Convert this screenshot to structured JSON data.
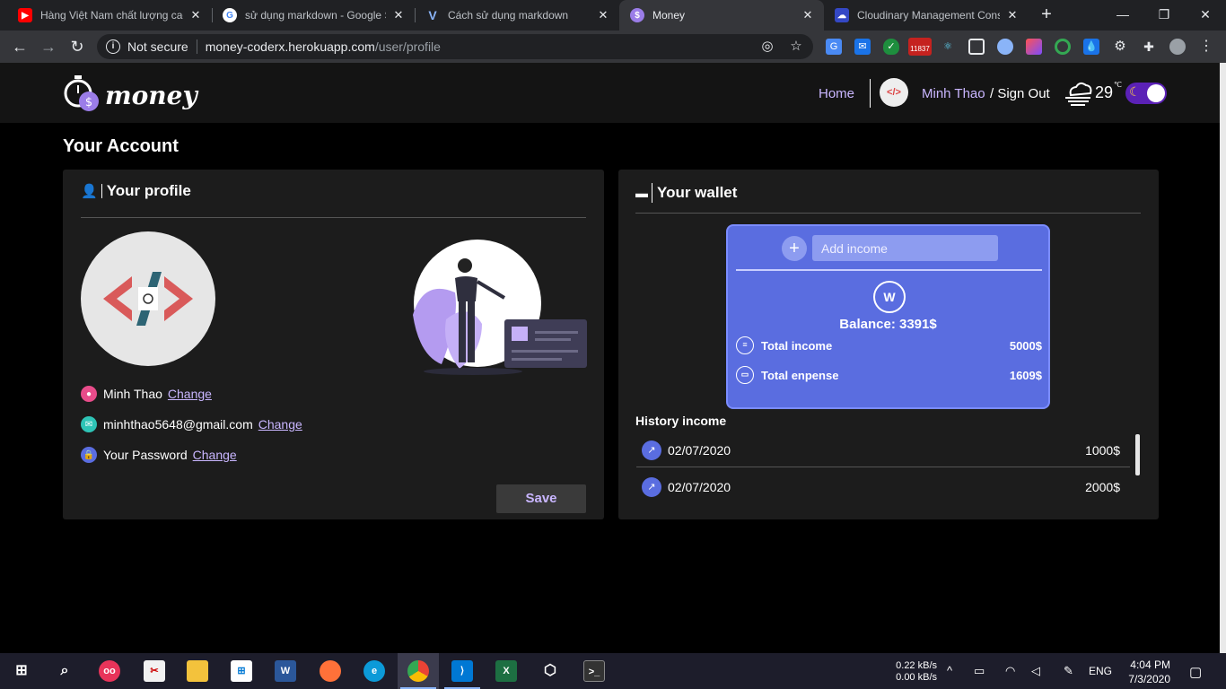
{
  "browser": {
    "tabs": [
      {
        "title": "Hàng Việt Nam chất lượng cao",
        "icon": "youtube-icon",
        "active": false
      },
      {
        "title": "sử dụng markdown - Google S",
        "icon": "google-icon",
        "active": false
      },
      {
        "title": "Cách sử dụng markdown",
        "icon": "v-icon",
        "active": false
      },
      {
        "title": "Money",
        "icon": "money-icon",
        "active": true
      },
      {
        "title": "Cloudinary Management Cons",
        "icon": "cloudinary-icon",
        "active": false
      }
    ],
    "close_glyph": "✕",
    "security_label": "Not secure",
    "url_host": "money-coderx.herokuapp.com",
    "url_path": "/user/profile",
    "ext_badge": "11837"
  },
  "navbar": {
    "logo_text": "money",
    "home_label": "Home",
    "user_name": "Minh Thao",
    "signout_label": "/ Sign Out",
    "temperature": "29",
    "temp_unit": "℃",
    "avatar_glyph": "</>"
  },
  "page_title": "Your Account",
  "profile": {
    "heading": "Your profile",
    "name": "Minh Thao",
    "email": "minhthao5648@gmail.com",
    "password_label": "Your Password",
    "change_label": "Change",
    "save_label": "Save"
  },
  "wallet": {
    "heading": "Your wallet",
    "add_income_placeholder": "Add income",
    "balance_label": "Balance: 3391$",
    "total_income_label": "Total income",
    "total_income_value": "5000$",
    "total_expense_label": "Total enpense",
    "total_expense_value": "1609$",
    "history_title": "History income",
    "history": [
      {
        "date": "02/07/2020",
        "amount": "1000$"
      },
      {
        "date": "02/07/2020",
        "amount": "2000$"
      }
    ]
  },
  "taskbar": {
    "net_up": "0.22 kB/s",
    "net_down": "0.00 kB/s",
    "language": "ENG",
    "time": "4:04 PM",
    "date": "7/3/2020"
  },
  "colors": {
    "accent": "#c9b6ff",
    "wallet_card": "#5a6de0",
    "card_bg": "#1c1c1c"
  }
}
